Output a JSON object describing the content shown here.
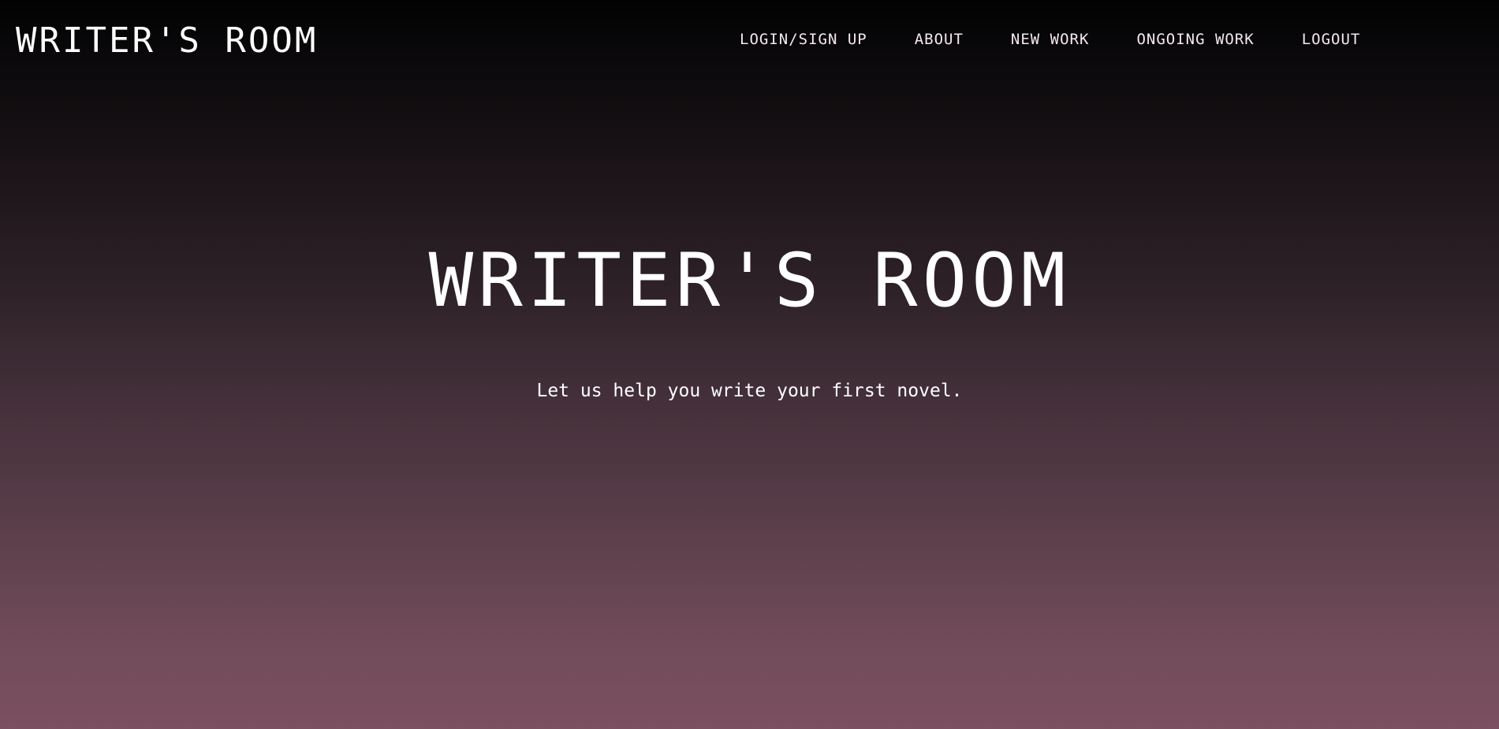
{
  "header": {
    "brand": "WRITER'S ROOM"
  },
  "nav": {
    "items": [
      {
        "label": "LOGIN/SIGN UP"
      },
      {
        "label": "ABOUT"
      },
      {
        "label": "NEW WORK"
      },
      {
        "label": "ONGOING WORK"
      },
      {
        "label": "LOGOUT"
      }
    ]
  },
  "hero": {
    "title": "WRITER'S ROOM",
    "subtitle": "Let us help you write your first novel."
  },
  "colors": {
    "background_top": "#020203",
    "background_bottom": "#7b5060",
    "text": "#ffffff"
  }
}
